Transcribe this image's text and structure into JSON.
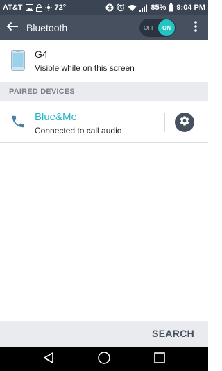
{
  "status_bar": {
    "carrier": "AT&T",
    "temperature": "72°",
    "battery": "85%",
    "time": "9:04 PM"
  },
  "action_bar": {
    "title": "Bluetooth",
    "toggle_off_label": "OFF",
    "toggle_on_label": "ON",
    "toggle_state": "on",
    "accent_color": "#22c4c4"
  },
  "this_device": {
    "name": "G4",
    "visibility": "Visible while on this screen"
  },
  "paired_section": {
    "header": "PAIRED DEVICES",
    "devices": [
      {
        "name": "Blue&Me",
        "status": "Connected to call audio",
        "icon": "phone-handset-icon"
      }
    ]
  },
  "bottom_bar": {
    "search_label": "SEARCH"
  },
  "nav_bar": {
    "icons": [
      "back-icon",
      "home-icon",
      "recents-icon"
    ]
  }
}
